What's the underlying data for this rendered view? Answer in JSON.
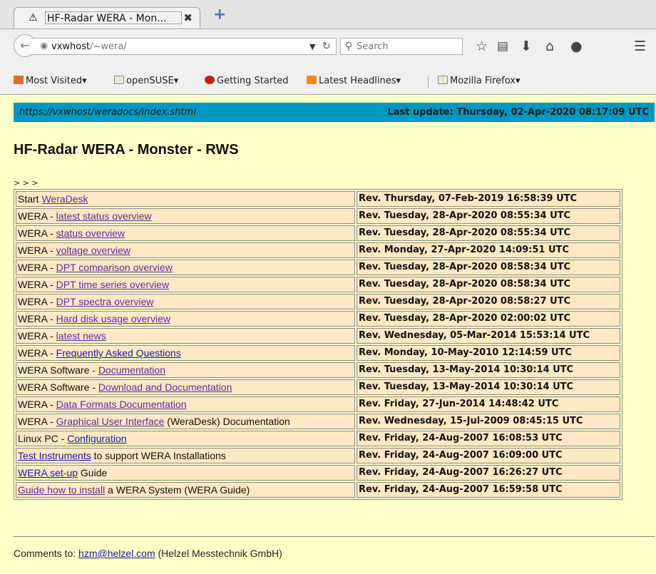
{
  "browser": {
    "tab_title": "HF-Radar WERA - Mon...",
    "tab_close": "✖",
    "new_tab": "+",
    "url_host": "vxwhost",
    "url_path": "/~wera/",
    "search_placeholder": "Search",
    "bookmarks": [
      {
        "label": "Most Visited",
        "dropdown": true
      },
      {
        "label": "openSUSE",
        "dropdown": true
      },
      {
        "label": "Getting Started",
        "dropdown": false
      },
      {
        "label": "Latest Headlines",
        "dropdown": true
      },
      {
        "label": "Mozilla Firefox",
        "dropdown": true
      }
    ]
  },
  "banner": {
    "url": "https://vxwhost/weradocs/index.shtml",
    "last_update": "Last update: Thursday, 02-Apr-2020 08:17:09 UTC"
  },
  "page_title": "HF-Radar WERA - Monster - RWS",
  "breadcrumb": "> > >",
  "rows": [
    {
      "prefix": "Start ",
      "link": "WeraDesk",
      "suffix": "",
      "rev": "Rev. Thursday, 07-Feb-2019 16:58:39 UTC",
      "visited": true
    },
    {
      "prefix": "WERA - ",
      "link": "latest status overview",
      "suffix": "",
      "rev": "Rev. Tuesday, 28-Apr-2020 08:55:34 UTC",
      "visited": true
    },
    {
      "prefix": "WERA - ",
      "link": "status overview",
      "suffix": "",
      "rev": "Rev. Tuesday, 28-Apr-2020 08:55:34 UTC",
      "visited": true
    },
    {
      "prefix": "WERA - ",
      "link": "voltage overview",
      "suffix": "",
      "rev": "Rev. Monday, 27-Apr-2020 14:09:51 UTC",
      "visited": true
    },
    {
      "prefix": "WERA - ",
      "link": "DPT comparison overview",
      "suffix": "",
      "rev": "Rev. Tuesday, 28-Apr-2020 08:58:34 UTC",
      "visited": true
    },
    {
      "prefix": "WERA - ",
      "link": "DPT time series overview",
      "suffix": "",
      "rev": "Rev. Tuesday, 28-Apr-2020 08:58:34 UTC",
      "visited": true
    },
    {
      "prefix": "WERA - ",
      "link": "DPT spectra overview",
      "suffix": "",
      "rev": "Rev. Tuesday, 28-Apr-2020 08:58:27 UTC",
      "visited": true
    },
    {
      "prefix": "WERA - ",
      "link": "Hard disk usage overview",
      "suffix": "",
      "rev": "Rev. Tuesday, 28-Apr-2020 02:00:02 UTC",
      "visited": true
    },
    {
      "prefix": "WERA - ",
      "link": "latest news",
      "suffix": "",
      "rev": "Rev. Wednesday, 05-Mar-2014 15:53:14 UTC",
      "visited": true
    },
    {
      "prefix": "WERA - ",
      "link": "Frequently Asked Questions",
      "suffix": "",
      "rev": "Rev. Monday, 10-May-2010 12:14:59 UTC",
      "visited": false
    },
    {
      "prefix": "WERA Software - ",
      "link": "Documentation",
      "suffix": "",
      "rev": "Rev. Tuesday, 13-May-2014 10:30:14 UTC",
      "visited": true
    },
    {
      "prefix": "WERA Software - ",
      "link": "Download and Documentation",
      "suffix": "",
      "rev": "Rev. Tuesday, 13-May-2014 10:30:14 UTC",
      "visited": true
    },
    {
      "prefix": "WERA - ",
      "link": "Data Formats Documentation",
      "suffix": "",
      "rev": "Rev. Friday, 27-Jun-2014 14:48:42 UTC",
      "visited": true
    },
    {
      "prefix": "WERA - ",
      "link": "Graphical User Interface",
      "suffix": " (WeraDesk) Documentation",
      "rev": "Rev. Wednesday, 15-Jul-2009 08:45:15 UTC",
      "visited": true
    },
    {
      "prefix": "Linux PC - ",
      "link": "Configuration",
      "suffix": "",
      "rev": "Rev. Friday, 24-Aug-2007 16:08:53 UTC",
      "visited": false
    },
    {
      "prefix": "",
      "link": "Test Instruments",
      "suffix": " to support WERA Installations",
      "rev": "Rev. Friday, 24-Aug-2007 16:09:00 UTC",
      "visited": false
    },
    {
      "prefix": "",
      "link": "WERA set-up",
      "suffix": " Guide",
      "rev": "Rev. Friday, 24-Aug-2007 16:26:27 UTC",
      "visited": false
    },
    {
      "prefix": "",
      "link": "Guide how to install",
      "suffix": " a WERA System (WERA Guide)",
      "rev": "Rev. Friday, 24-Aug-2007 16:59:58 UTC",
      "visited": true
    }
  ],
  "footer": {
    "prefix": "Comments to: ",
    "email": "hzm@helzel.com",
    "suffix": " (Helzel Messtechnik GmbH)"
  },
  "colors": {
    "page_bg": "#ffffc8",
    "banner_bg": "#0098c0",
    "cell_bg": "#ffe8c4",
    "visited_link": "#5a2ea0",
    "link": "#1a1aa6"
  }
}
